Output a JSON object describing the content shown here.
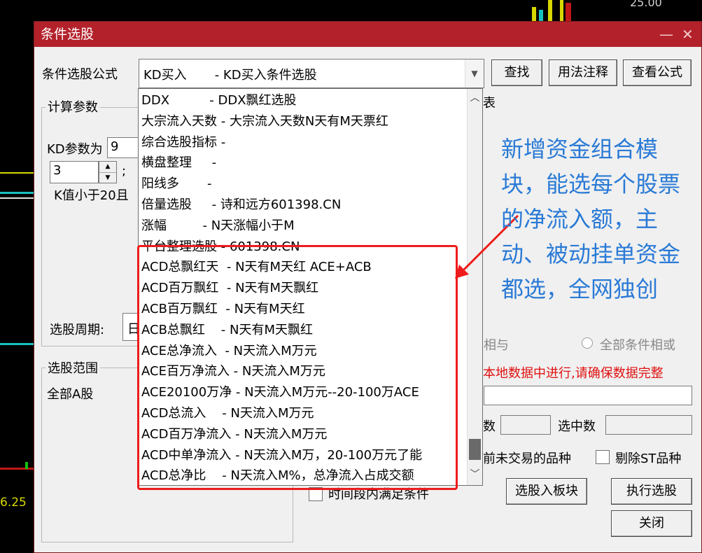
{
  "background": {
    "price_right": "25.00",
    "price_left": "6.25"
  },
  "dialog": {
    "title": "条件选股",
    "min_icon": "—",
    "close_icon": "✕",
    "formula_label": "条件选股公式",
    "formula_value": "KD买入       - KD买入条件选股",
    "btn_find": "查找",
    "btn_usage": "用法注释",
    "btn_view": "查看公式",
    "group_params": "计算参数",
    "kd_param_label": "KD参数为",
    "kd_param_value": "9",
    "spin_value": "3",
    "colon": ";",
    "k_condition": "K值小于20且",
    "period_label": "选股周期:",
    "period_value": "日",
    "group_range": "选股范围",
    "range_value": "全部A股",
    "list_header_frag": "表",
    "radio_and": "相与",
    "radio_or": "全部条件相或",
    "warning": "本地数据中进行,请确保数据完整",
    "count_label": "数",
    "selected_label": "选中数",
    "exclude_suspended": "前未交易的品种",
    "exclude_st": "剔除ST品种",
    "time_segment": "时间段内满足条件",
    "btn_to_block": "选股入板块",
    "btn_execute": "执行选股",
    "btn_close": "关闭"
  },
  "dropdown_items": [
    "DDX          - DDX飘红选股",
    "大宗流入天数 - 大宗流入天数N天有M天票红",
    "综合选股指标 -",
    "横盘整理     -",
    "阳线多       -",
    "倍量选股     - 诗和远方601398.CN",
    "涨幅         - N天涨幅小于M",
    "平台整理选股 - 601398.CN",
    "ACD总飘红天  - N天有M天红 ACE+ACB",
    "ACD百万飘红  - N天有M天飘红",
    "ACB百万飘红  - N天有M天红",
    "ACB总飘红    - N天有M天飘红",
    "ACE总净流入  - N天流入M万元",
    "ACE百万净流入 - N天流入M万元",
    "ACE20100万净 - N天流入M万元--20-100万ACE",
    "ACD总流入    - N天流入M万元",
    "ACD百万净流入 - N天流入M万元",
    "ACD中单净流入 - N天流入M万，20-100万元了能",
    "ACD总净比    - N天流入M%，总净流入占成交额"
  ],
  "annotation": "新增资金组合模块，能选每个股票的净流入额，主动、被动挂单资金都选，全网独创",
  "colors": {
    "titlebar": "#b3222b",
    "annotation": "#2a7ad6",
    "highlight_box": "#ee1c1c",
    "warning": "#e01010"
  }
}
